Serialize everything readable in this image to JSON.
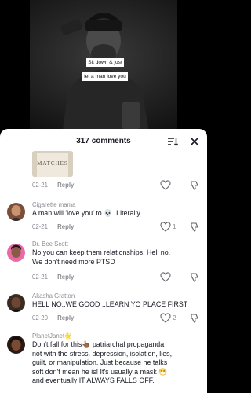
{
  "video": {
    "caption_line1": "Sit down & just",
    "caption_line2": "let a man love you"
  },
  "sheet": {
    "comment_count": "317 comments"
  },
  "comments": [
    {
      "image_label": "MATCHES",
      "date": "02-21",
      "reply": "Reply",
      "likes": ""
    },
    {
      "username": "Cigarette mama",
      "text": "A man will 'love you' to 💀. Literally.",
      "date": "02-21",
      "reply": "Reply",
      "likes": "1"
    },
    {
      "username": "Dr. Bee Scott",
      "text_line1": "No you can keep them relationships. Hell no.",
      "text_line2": "We don't need more PTSD",
      "date": "02-21",
      "reply": "Reply",
      "likes": ""
    },
    {
      "username": "Akasha Gratton",
      "text": "HELL NO..WE GOOD ..LEARN YO PLACE FIRST",
      "date": "02-20",
      "reply": "Reply",
      "likes": "2"
    },
    {
      "username": "PlanetJanet🌟",
      "text_line1": "Don't fall for this👆🏾 patriarchal propaganda",
      "text_line2": "not with the stress, depression, isolation, lies,",
      "text_line3": "guilt, or manipulation. Just because he talks",
      "text_line4": "soft don't mean he is! It's usually a mask 😷",
      "text_line5": "and eventually IT ALWAYS FALLS OFF."
    }
  ],
  "icons": {
    "sort": "sort-icon",
    "close": "close-icon",
    "like": "heart-outline-icon",
    "dislike": "thumbs-down-icon"
  }
}
